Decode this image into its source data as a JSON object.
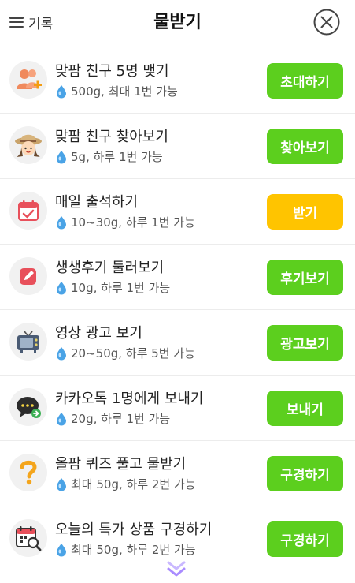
{
  "header": {
    "menu_label": "기록",
    "title": "물받기"
  },
  "colors": {
    "green_button": "#5ccf1e",
    "yellow_button": "#ffc400",
    "drop": "#4aa3e6"
  },
  "tasks": [
    {
      "title": "맞팜 친구 5명 맺기",
      "detail": "500g, 최대 1번 가능",
      "button": "초대하기",
      "icon": "friends-add-icon",
      "button_color": "green"
    },
    {
      "title": "맞팜 친구 찾아보기",
      "detail": "5g, 하루 1번 가능",
      "button": "찾아보기",
      "icon": "farmer-avatar-icon",
      "button_color": "green"
    },
    {
      "title": "매일 출석하기",
      "detail": "10~30g, 하루 1번 가능",
      "button": "받기",
      "icon": "calendar-check-icon",
      "button_color": "yellow"
    },
    {
      "title": "생생후기 둘러보기",
      "detail": "10g, 하루 1번 가능",
      "button": "후기보기",
      "icon": "pencil-edit-icon",
      "button_color": "green"
    },
    {
      "title": "영상 광고 보기",
      "detail": "20~50g, 하루 5번 가능",
      "button": "광고보기",
      "icon": "tv-icon",
      "button_color": "green"
    },
    {
      "title": "카카오톡 1명에게 보내기",
      "detail": "20g, 하루 1번 가능",
      "button": "보내기",
      "icon": "chat-share-icon",
      "button_color": "green"
    },
    {
      "title": "올팜 퀴즈 풀고 물받기",
      "detail": "최대 50g, 하루 2번 가능",
      "button": "구경하기",
      "icon": "question-mark-icon",
      "button_color": "green"
    },
    {
      "title": "오늘의 특가 상품 구경하기",
      "detail": "최대 50g, 하루 2번 가능",
      "button": "구경하기",
      "icon": "calendar-search-icon",
      "button_color": "green"
    }
  ]
}
